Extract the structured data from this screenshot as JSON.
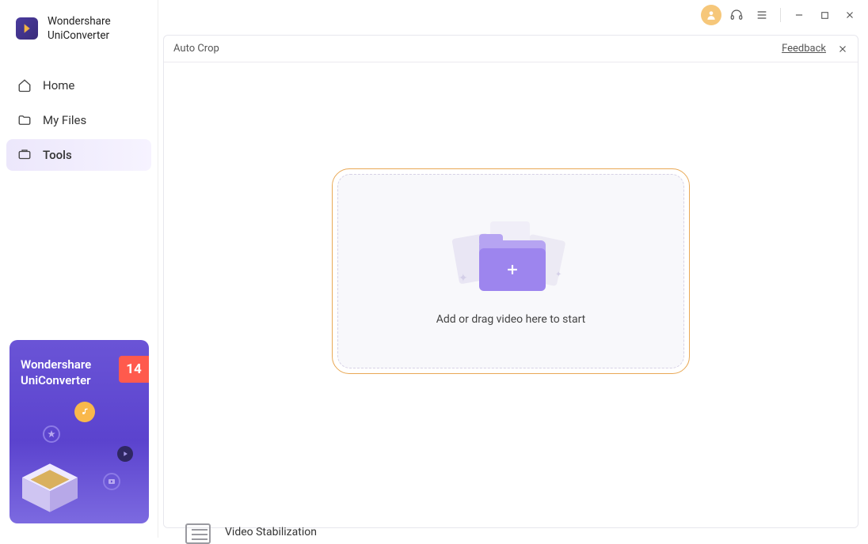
{
  "brand": {
    "line1": "Wondershare",
    "line2": "UniConverter"
  },
  "sidebar": {
    "items": [
      {
        "label": "Home"
      },
      {
        "label": "My Files"
      },
      {
        "label": "Tools"
      }
    ]
  },
  "promo": {
    "title_line1": "Wondershare",
    "title_line2": "UniConverter",
    "badge": "14"
  },
  "titlebar": {},
  "panel": {
    "title": "Auto Crop",
    "feedback": "Feedback"
  },
  "dropzone": {
    "text": "Add or drag video here to start"
  },
  "peek": {
    "label": "Video Stabilization"
  }
}
